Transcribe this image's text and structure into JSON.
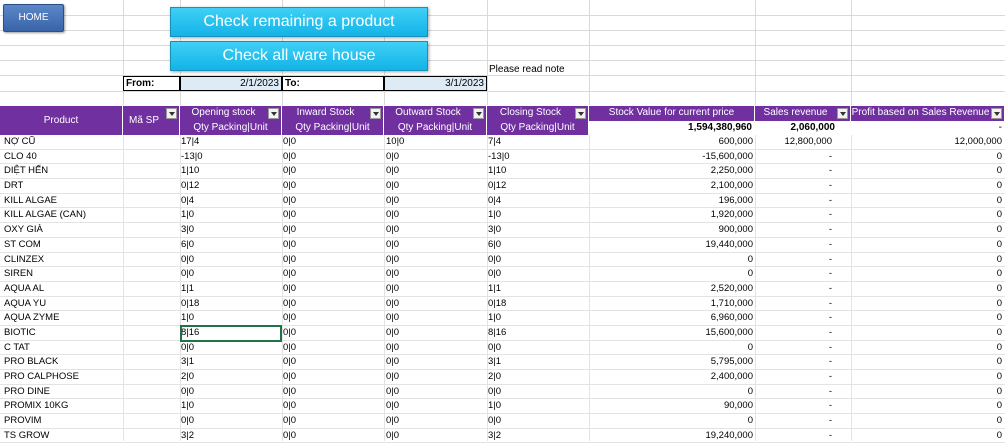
{
  "buttons": {
    "home": "HOME",
    "check_product": "Check remaining a product",
    "check_warehouse": "Check all ware house"
  },
  "note": "Please read note",
  "date_range": {
    "from_label": "From:",
    "from_value": "2/1/2023",
    "to_label": "To:",
    "to_value": "3/1/2023"
  },
  "headers": {
    "product": "Product",
    "code": "Mã SP",
    "opening": "Opening stock",
    "inward": "Inward Stock",
    "outward": "Outward Stock",
    "closing": "Closing Stock",
    "stock_value": "Stock Value for current price",
    "sales_revenue": "Sales revenue",
    "profit": "Profit based on Sales Revenue",
    "sub_qty": "Qty Packing|Unit"
  },
  "totals": {
    "stock_value": "1,594,380,960",
    "sales_revenue": "2,060,000",
    "profit": "-"
  },
  "rows": [
    {
      "product": "NỢ CŨ",
      "open": "17|4",
      "in": "0|0",
      "out": "10|0",
      "close": "7|4",
      "value": "600,000",
      "sales": "12,800,000",
      "profit": "12,000,000"
    },
    {
      "product": "CLO 40",
      "open": "-13|0",
      "in": "0|0",
      "out": "0|0",
      "close": "-13|0",
      "value": "-15,600,000",
      "sales": "-",
      "profit": "0"
    },
    {
      "product": "DIỆT HẾN",
      "open": "1|10",
      "in": "0|0",
      "out": "0|0",
      "close": "1|10",
      "value": "2,250,000",
      "sales": "-",
      "profit": "0"
    },
    {
      "product": "DRT",
      "open": "0|12",
      "in": "0|0",
      "out": "0|0",
      "close": "0|12",
      "value": "2,100,000",
      "sales": "-",
      "profit": "0"
    },
    {
      "product": "KILL ALGAE",
      "open": "0|4",
      "in": "0|0",
      "out": "0|0",
      "close": "0|4",
      "value": "196,000",
      "sales": "-",
      "profit": "0"
    },
    {
      "product": "KILL ALGAE (CAN)",
      "open": "1|0",
      "in": "0|0",
      "out": "0|0",
      "close": "1|0",
      "value": "1,920,000",
      "sales": "-",
      "profit": "0"
    },
    {
      "product": "OXY GIÀ",
      "open": "3|0",
      "in": "0|0",
      "out": "0|0",
      "close": "3|0",
      "value": "900,000",
      "sales": "-",
      "profit": "0"
    },
    {
      "product": "ST COM",
      "open": "6|0",
      "in": "0|0",
      "out": "0|0",
      "close": "6|0",
      "value": "19,440,000",
      "sales": "-",
      "profit": "0"
    },
    {
      "product": "CLINZEX",
      "open": "0|0",
      "in": "0|0",
      "out": "0|0",
      "close": "0|0",
      "value": "0",
      "sales": "-",
      "profit": "0"
    },
    {
      "product": "SIREN",
      "open": "0|0",
      "in": "0|0",
      "out": "0|0",
      "close": "0|0",
      "value": "0",
      "sales": "-",
      "profit": "0"
    },
    {
      "product": "AQUA AL",
      "open": "1|1",
      "in": "0|0",
      "out": "0|0",
      "close": "1|1",
      "value": "2,520,000",
      "sales": "-",
      "profit": "0"
    },
    {
      "product": "AQUA YU",
      "open": "0|18",
      "in": "0|0",
      "out": "0|0",
      "close": "0|18",
      "value": "1,710,000",
      "sales": "-",
      "profit": "0"
    },
    {
      "product": "AQUA ZYME",
      "open": "1|0",
      "in": "0|0",
      "out": "0|0",
      "close": "1|0",
      "value": "6,960,000",
      "sales": "-",
      "profit": "0"
    },
    {
      "product": "BIOTIC",
      "open": "8|16",
      "in": "0|0",
      "out": "0|0",
      "close": "8|16",
      "value": "15,600,000",
      "sales": "-",
      "profit": "0"
    },
    {
      "product": "C TAT",
      "open": "0|0",
      "in": "0|0",
      "out": "0|0",
      "close": "0|0",
      "value": "0",
      "sales": "-",
      "profit": "0"
    },
    {
      "product": "PRO BLACK",
      "open": "3|1",
      "in": "0|0",
      "out": "0|0",
      "close": "3|1",
      "value": "5,795,000",
      "sales": "-",
      "profit": "0"
    },
    {
      "product": "PRO CALPHOSE",
      "open": "2|0",
      "in": "0|0",
      "out": "0|0",
      "close": "2|0",
      "value": "2,400,000",
      "sales": "-",
      "profit": "0"
    },
    {
      "product": "PRO DINE",
      "open": "0|0",
      "in": "0|0",
      "out": "0|0",
      "close": "0|0",
      "value": "0",
      "sales": "-",
      "profit": "0"
    },
    {
      "product": "PROMIX 10KG",
      "open": "1|0",
      "in": "0|0",
      "out": "0|0",
      "close": "1|0",
      "value": "90,000",
      "sales": "-",
      "profit": "0"
    },
    {
      "product": "PROVIM",
      "open": "0|0",
      "in": "0|0",
      "out": "0|0",
      "close": "0|0",
      "value": "0",
      "sales": "-",
      "profit": "0"
    },
    {
      "product": "TS GROW",
      "open": "3|2",
      "in": "0|0",
      "out": "0|0",
      "close": "3|2",
      "value": "19,240,000",
      "sales": "-",
      "profit": "0"
    }
  ],
  "selected_row": 13,
  "colors": {
    "header_purple": "#7030a0",
    "button_cyan": "#13b4e8",
    "home_blue": "#3a64a8"
  }
}
